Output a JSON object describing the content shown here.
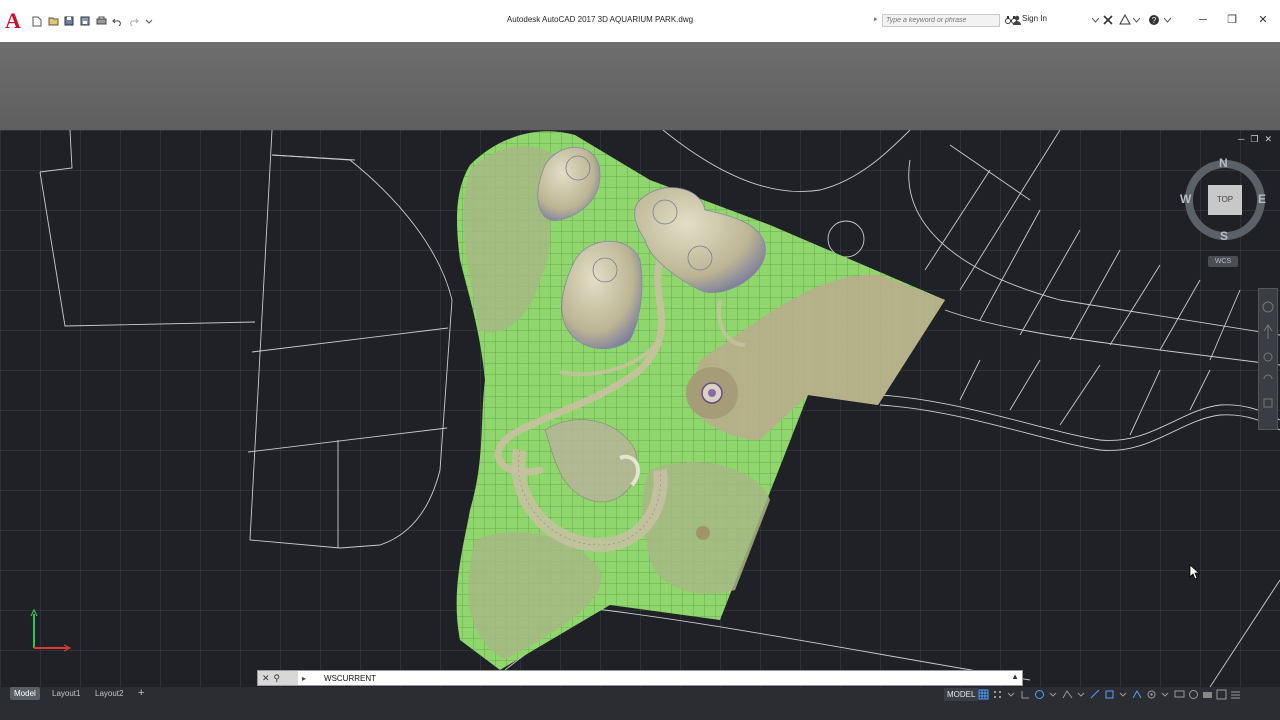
{
  "app": {
    "logo_letter": "A",
    "window_title": "Autodesk AutoCAD 2017    3D AQUARIUM PARK.dwg"
  },
  "quick_access": {
    "icons": [
      "new-icon",
      "open-icon",
      "save-icon",
      "save-as-icon",
      "plot-icon",
      "undo-icon",
      "redo-icon",
      "customize-icon"
    ]
  },
  "search": {
    "placeholder": "Type a keyword or phrase"
  },
  "account": {
    "sign_in_label": "Sign In"
  },
  "window_controls": {
    "minimize": "─",
    "restore": "❐",
    "close": "✕"
  },
  "viewport": {
    "controls": {
      "minimize": "─",
      "restore": "❐",
      "close": "✕"
    },
    "viewcube": {
      "north": "N",
      "south": "S",
      "east": "E",
      "west": "W",
      "face": "TOP",
      "coord_system": "WCS"
    }
  },
  "command_line": {
    "close_glyph": "✕",
    "search_glyph": "⚲",
    "text": "WSCURRENT",
    "expand_glyph": "▲"
  },
  "status_bar": {
    "tabs": [
      "Model",
      "Layout1",
      "Layout2"
    ],
    "add_tab": "+",
    "space": "MODEL"
  },
  "colors": {
    "background": "#1f2127",
    "site_green": "#8fd66d",
    "path_tan": "#b9ad8c",
    "building": "#c9c3a6"
  }
}
